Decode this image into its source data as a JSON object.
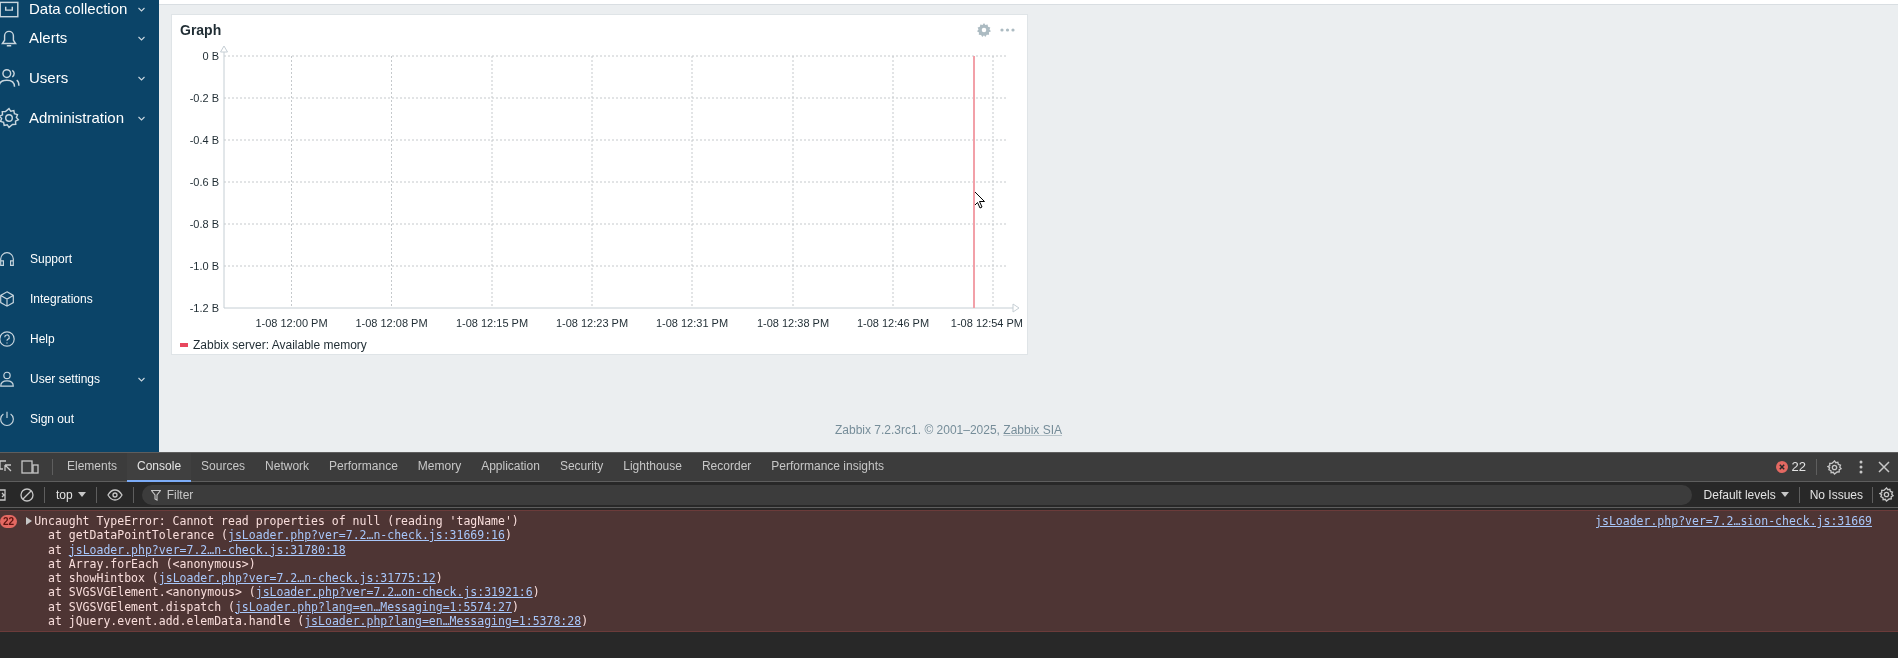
{
  "sidebar": {
    "items": [
      {
        "label": "Data collection",
        "expandable": true
      },
      {
        "label": "Alerts",
        "expandable": true
      },
      {
        "label": "Users",
        "expandable": true
      },
      {
        "label": "Administration",
        "expandable": true
      }
    ],
    "bottom_items": [
      {
        "label": "Support",
        "expandable": false
      },
      {
        "label": "Integrations",
        "expandable": false
      },
      {
        "label": "Help",
        "expandable": false
      },
      {
        "label": "User settings",
        "expandable": true
      },
      {
        "label": "Sign out",
        "expandable": false
      }
    ]
  },
  "widget": {
    "title": "Graph",
    "chart_data": {
      "type": "line",
      "categories": [
        "1-08 12:00 PM",
        "1-08 12:08 PM",
        "1-08 12:15 PM",
        "1-08 12:23 PM",
        "1-08 12:31 PM",
        "1-08 12:38 PM",
        "1-08 12:46 PM",
        "1-08 12:54 PM"
      ],
      "ylim": [
        -1.2,
        0
      ],
      "grid": true,
      "yticks": [
        {
          "value": 0,
          "label": "0 B"
        },
        {
          "value": -0.2,
          "label": "-0.2 B"
        },
        {
          "value": -0.4,
          "label": "-0.4 B"
        },
        {
          "value": -0.6,
          "label": "-0.6 B"
        },
        {
          "value": -0.8,
          "label": "-0.8 B"
        },
        {
          "value": -1.0,
          "label": "-1.0 B"
        },
        {
          "value": -1.2,
          "label": "-1.2 B"
        }
      ],
      "series": [
        {
          "name": "Zabbix server: Available memory",
          "color": "#e8475e",
          "values": [
            null,
            null,
            null,
            null,
            null,
            null,
            null,
            null
          ]
        }
      ]
    }
  },
  "footer": {
    "text": "Zabbix 7.2.3rc1. © 2001–2025, ",
    "link": "Zabbix SIA"
  },
  "devtools": {
    "tabs": [
      {
        "label": "Elements",
        "selected": false
      },
      {
        "label": "Console",
        "selected": true
      },
      {
        "label": "Sources",
        "selected": false
      },
      {
        "label": "Network",
        "selected": false
      },
      {
        "label": "Performance",
        "selected": false
      },
      {
        "label": "Memory",
        "selected": false
      },
      {
        "label": "Application",
        "selected": false
      },
      {
        "label": "Security",
        "selected": false
      },
      {
        "label": "Lighthouse",
        "selected": false
      },
      {
        "label": "Recorder",
        "selected": false
      },
      {
        "label": "Performance insights",
        "selected": false
      }
    ],
    "error_count": "22",
    "context": "top",
    "filter_placeholder": "Filter",
    "levels": "Default levels",
    "issues": "No Issues",
    "message": {
      "count": "22",
      "text": "Uncaught TypeError: Cannot read properties of null (reading 'tagName')",
      "source": "jsLoader.php?ver=7.2…sion-check.js:31669",
      "stack": [
        {
          "prefix": "at getDataPointTolerance (",
          "link": "jsLoader.php?ver=7.2…n-check.js:31669:16",
          "suffix": ")"
        },
        {
          "prefix": "at ",
          "link": "jsLoader.php?ver=7.2…n-check.js:31780:18"
        },
        {
          "prefix": "at Array.forEach (<anonymous>)"
        },
        {
          "prefix": "at showHintbox (",
          "link": "jsLoader.php?ver=7.2…n-check.js:31775:12",
          "suffix": ")"
        },
        {
          "prefix": "at SVGSVGElement.<anonymous> (",
          "link": "jsLoader.php?ver=7.2…on-check.js:31921:6",
          "suffix": ")"
        },
        {
          "prefix": "at SVGSVGElement.dispatch (",
          "link": "jsLoader.php?lang=en…Messaging=1:5574:27",
          "suffix": ")"
        },
        {
          "prefix": "at jQuery.event.add.elemData.handle (",
          "link": "jsLoader.php?lang=en…Messaging=1:5378:28",
          "suffix": ")"
        }
      ]
    }
  }
}
